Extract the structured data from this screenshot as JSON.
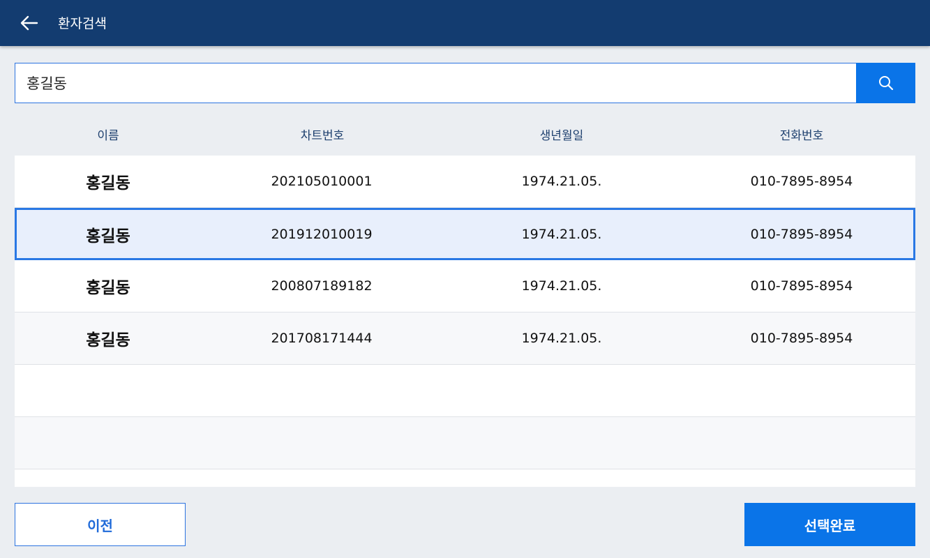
{
  "header": {
    "title": "환자검색",
    "back_icon": "arrow-left-icon",
    "background_color": "#133c70"
  },
  "search": {
    "value": "홍길동",
    "button_icon": "search-icon",
    "accent_color": "#0a74e8"
  },
  "table": {
    "columns": [
      "이름",
      "차트번호",
      "생년월일",
      "전화번호"
    ],
    "rows": [
      {
        "name": "홍길동",
        "chart_no": "202105010001",
        "birth": "1974.21.05.",
        "phone": "010-7895-8954"
      },
      {
        "name": "홍길동",
        "chart_no": "201912010019",
        "birth": "1974.21.05.",
        "phone": "010-7895-8954"
      },
      {
        "name": "홍길동",
        "chart_no": "200807189182",
        "birth": "1974.21.05.",
        "phone": "010-7895-8954"
      },
      {
        "name": "홍길동",
        "chart_no": "201708171444",
        "birth": "1974.21.05.",
        "phone": "010-7895-8954"
      }
    ],
    "selected_index": 1
  },
  "footer": {
    "prev_label": "이전",
    "done_label": "선택완료"
  }
}
